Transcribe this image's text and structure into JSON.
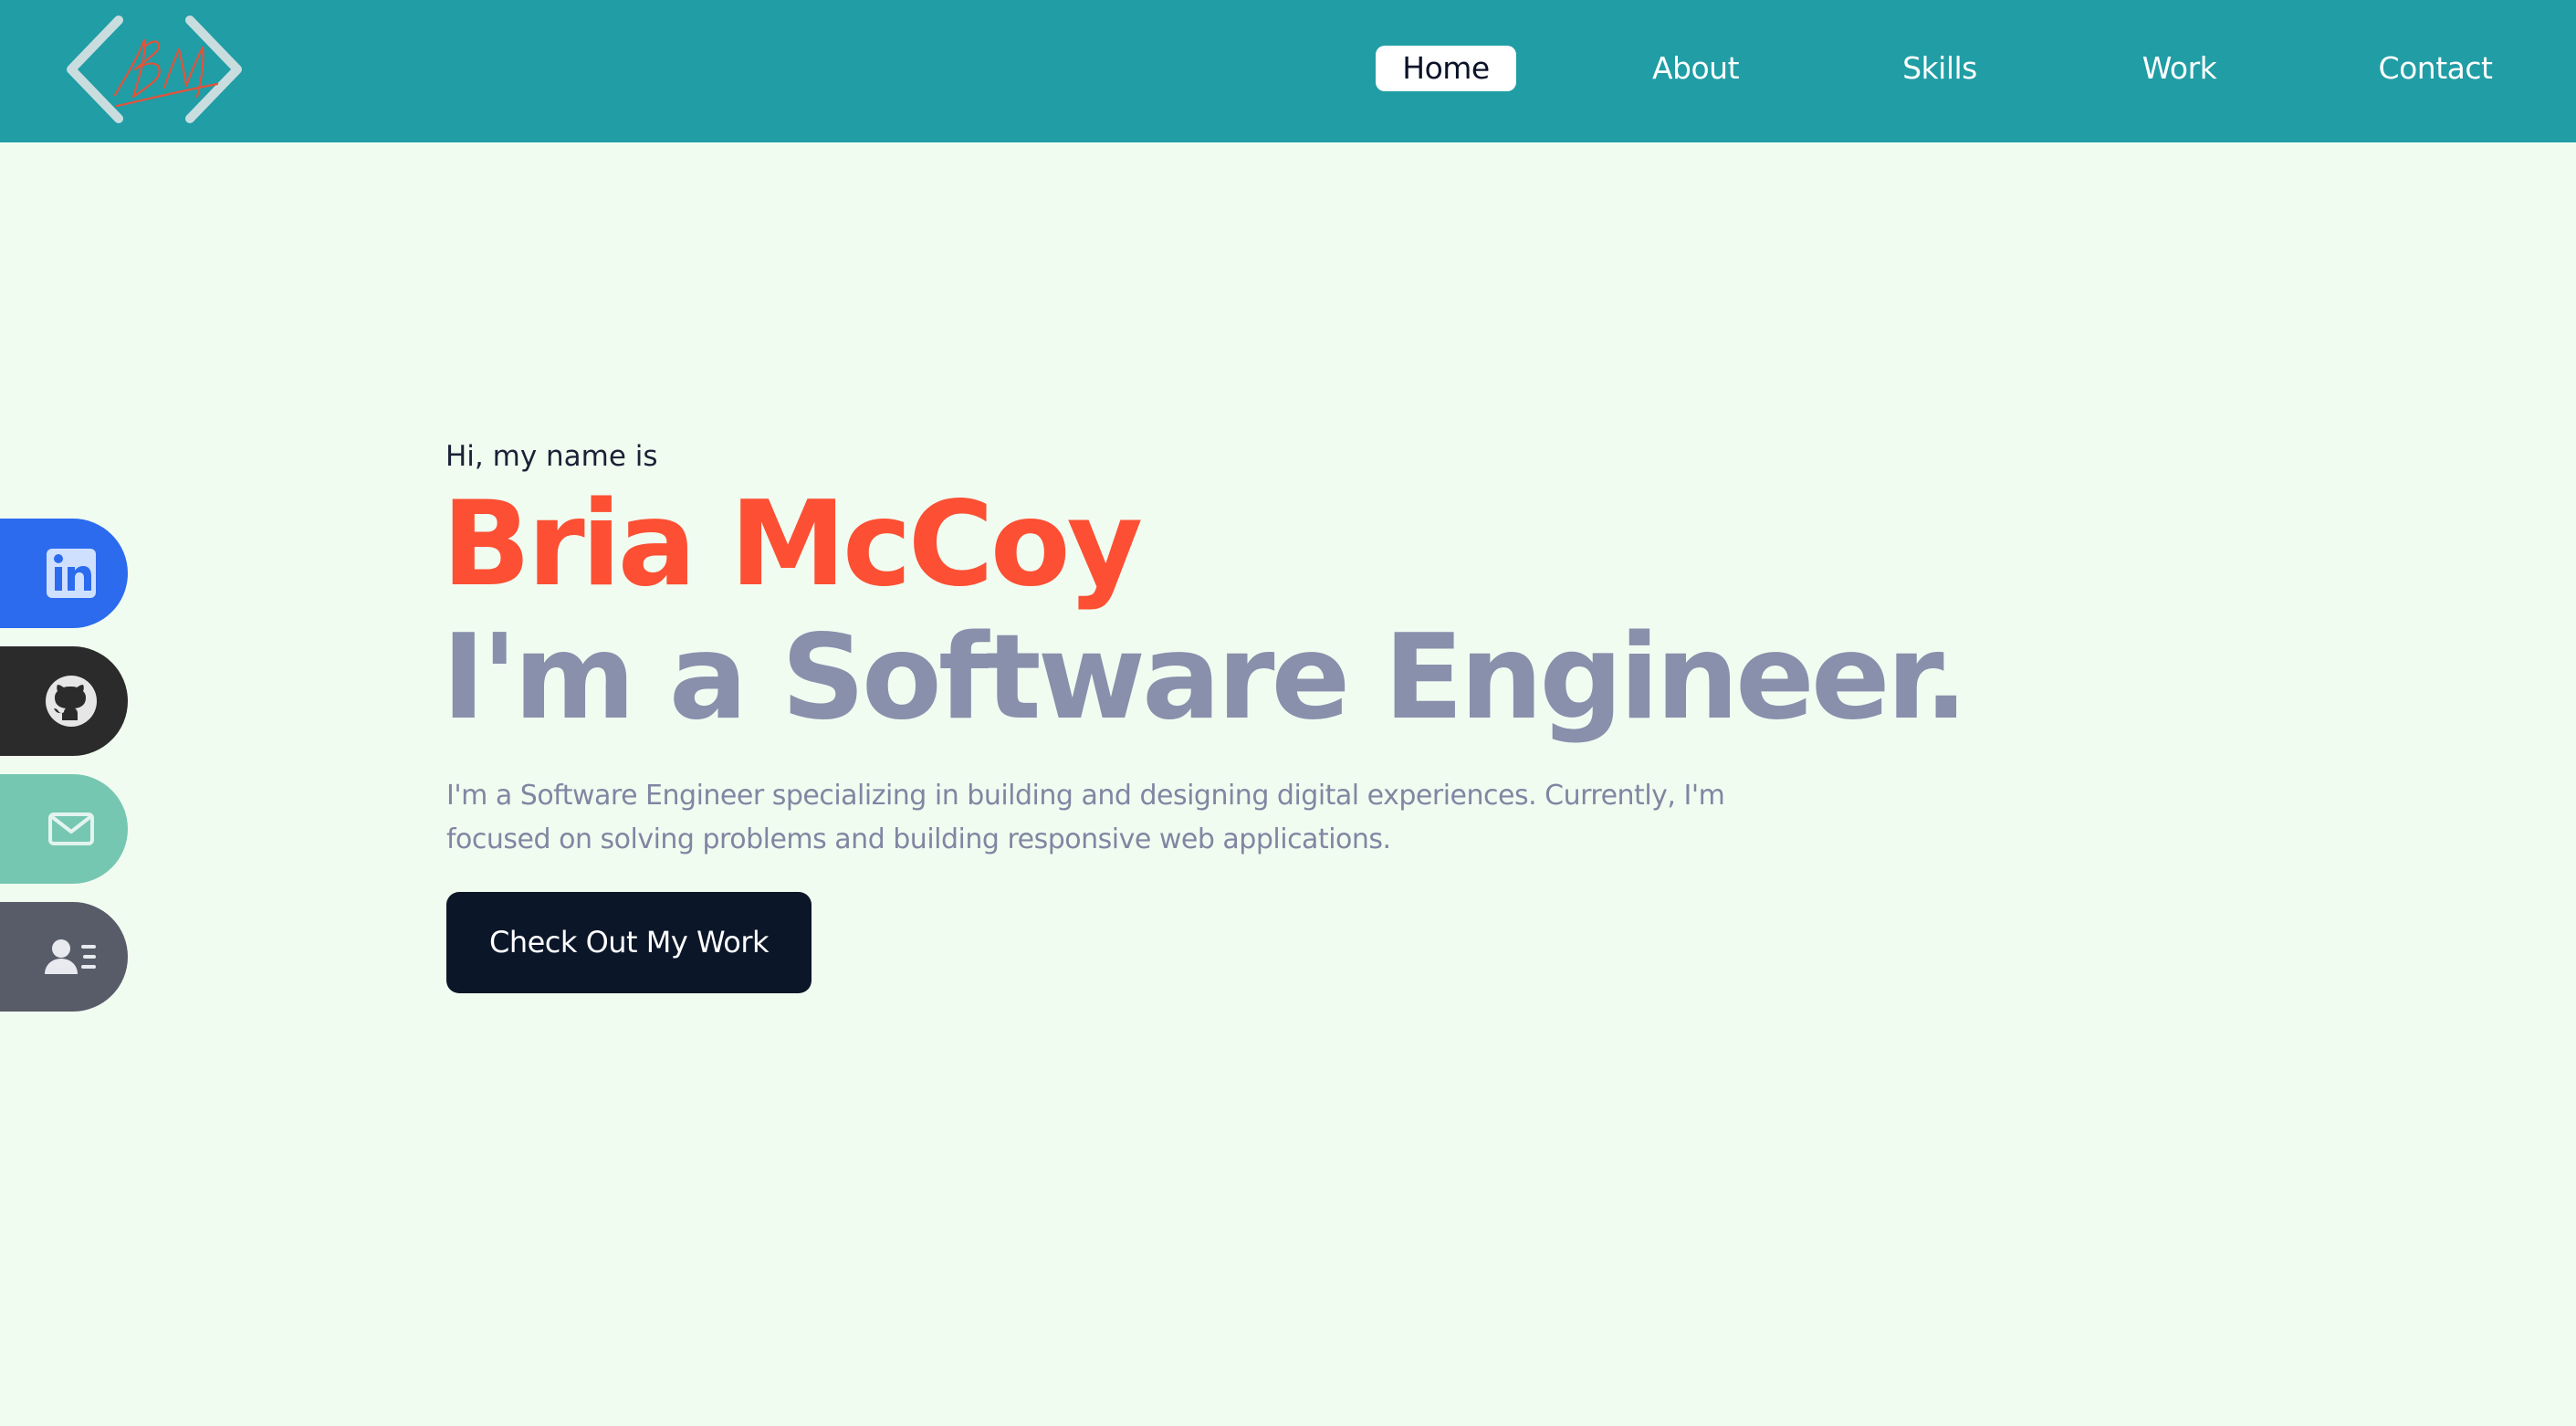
{
  "brand": {
    "logo_name": "bm-signature-logo",
    "colors": {
      "nav_bg": "#209da5",
      "page_bg": "#f1fcf1",
      "accent": "#fc4f33",
      "muted": "#8890ac",
      "dark": "#0b1629"
    }
  },
  "nav": {
    "items": [
      {
        "label": "Home",
        "active": true
      },
      {
        "label": "About",
        "active": false
      },
      {
        "label": "Skills",
        "active": false
      },
      {
        "label": "Work",
        "active": false
      },
      {
        "label": "Contact",
        "active": false
      }
    ]
  },
  "social": [
    {
      "icon": "linkedin-icon",
      "color": "#2c6bee"
    },
    {
      "icon": "github-icon",
      "color": "#2b2b2b"
    },
    {
      "icon": "mail-icon",
      "color": "#76c7b2"
    },
    {
      "icon": "resume-icon",
      "color": "#575c68"
    }
  ],
  "hero": {
    "intro": "Hi, my name is",
    "name": "Bria McCoy",
    "tagline": "I'm a Software Engineer.",
    "description": "I'm a Software Engineer specializing in building and designing digital experiences. Currently, I'm focused on solving problems and building responsive web applications.",
    "cta_label": "Check Out My Work"
  }
}
